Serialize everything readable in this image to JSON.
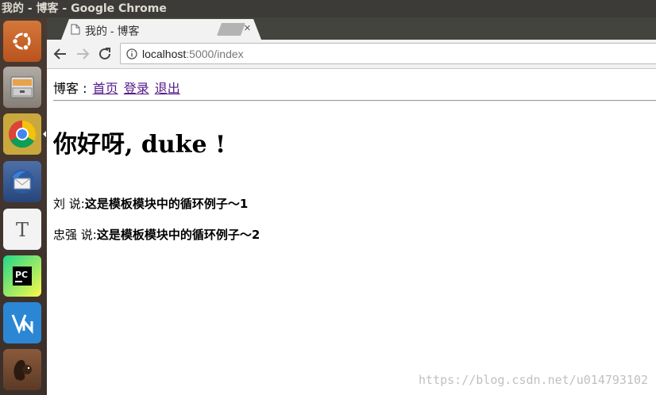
{
  "window": {
    "title": "我的 - 博客 - Google Chrome"
  },
  "launcher": {
    "items": [
      {
        "name": "ubuntu-dash"
      },
      {
        "name": "files"
      },
      {
        "name": "chrome"
      },
      {
        "name": "thunderbird"
      },
      {
        "name": "text-editor"
      },
      {
        "name": "pycharm"
      },
      {
        "name": "vnc-viewer"
      },
      {
        "name": "squirrel"
      }
    ]
  },
  "browser": {
    "tab_title": "我的 - 博客",
    "tab_close": "×",
    "url_host": "localhost",
    "url_path": ":5000/index"
  },
  "page": {
    "nav_prefix": "博客 :",
    "nav_links": [
      "首页",
      "登录",
      "退出"
    ],
    "greeting": "你好呀, duke !",
    "posts": [
      {
        "author": "刘",
        "says": " 说:",
        "body": "这是模板模块中的循环例子～1"
      },
      {
        "author": "忠强",
        "says": " 说:",
        "body": "这是模板模块中的循环例子～2"
      }
    ]
  },
  "watermark": "https://blog.csdn.net/u014793102"
}
